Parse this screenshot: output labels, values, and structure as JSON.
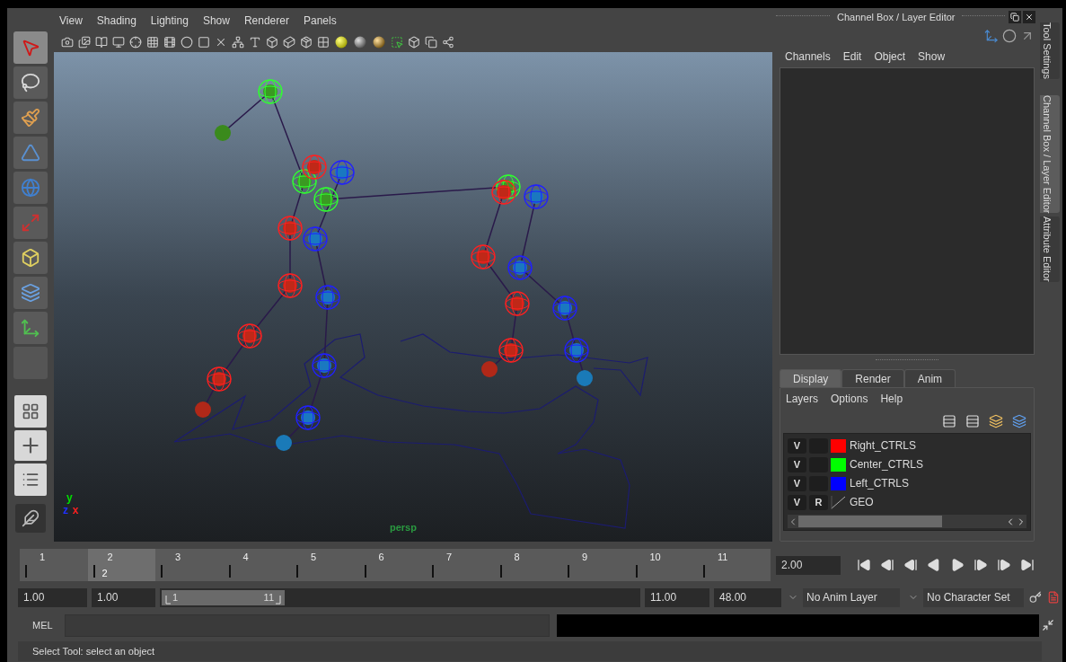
{
  "viewport": {
    "menu": [
      "View",
      "Shading",
      "Lighting",
      "Show",
      "Renderer",
      "Panels"
    ],
    "camera_label": "persp",
    "axis_labels": [
      {
        "text": "y",
        "color": "#00e000"
      },
      {
        "text": "z",
        "color": "#2030ff"
      },
      {
        "text": "x",
        "color": "#ff2020"
      }
    ]
  },
  "channel_box": {
    "title": "Channel Box / Layer Editor",
    "menu": [
      "Channels",
      "Edit",
      "Object",
      "Show"
    ]
  },
  "layer_editor": {
    "tabs": [
      {
        "label": "Display",
        "selected": true
      },
      {
        "label": "Render",
        "selected": false
      },
      {
        "label": "Anim",
        "selected": false
      }
    ],
    "menu": [
      "Layers",
      "Options",
      "Help"
    ],
    "layers": [
      {
        "visibility": "V",
        "color": "#ff0000",
        "name": "Right_CTRLS"
      },
      {
        "visibility": "V",
        "color": "#00ff00",
        "name": "Center_CTRLS"
      },
      {
        "visibility": "V",
        "color": "#0000ff",
        "name": "Left_CTRLS"
      },
      {
        "visibility": "V",
        "display_type": "R",
        "name": "GEO"
      }
    ]
  },
  "side_tabs": [
    {
      "label": "Tool Settings",
      "selected": false
    },
    {
      "label": "Channel Box / Layer Editor",
      "selected": true
    },
    {
      "label": "Attribute Editor",
      "selected": false
    }
  ],
  "timeline": {
    "frames": [
      {
        "label": "1",
        "selected": false
      },
      {
        "label": "2",
        "selected": true
      },
      {
        "label": "3",
        "selected": false
      },
      {
        "label": "4",
        "selected": false
      },
      {
        "label": "5",
        "selected": false
      },
      {
        "label": "6",
        "selected": false
      },
      {
        "label": "7",
        "selected": false
      },
      {
        "label": "8",
        "selected": false
      },
      {
        "label": "9",
        "selected": false
      },
      {
        "label": "10",
        "selected": false
      },
      {
        "label": "11",
        "selected": false
      }
    ],
    "current_frame": "2",
    "current_time": "2.00"
  },
  "range": {
    "start": "1.00",
    "playback_start": "1.00",
    "slider_start": "1",
    "slider_end": "11",
    "playback_end": "11.00",
    "end": "48.00",
    "anim_layer": "No Anim Layer",
    "character_set": "No Character Set"
  },
  "command_line": {
    "label": "MEL"
  },
  "status_bar": "Select Tool: select an object"
}
